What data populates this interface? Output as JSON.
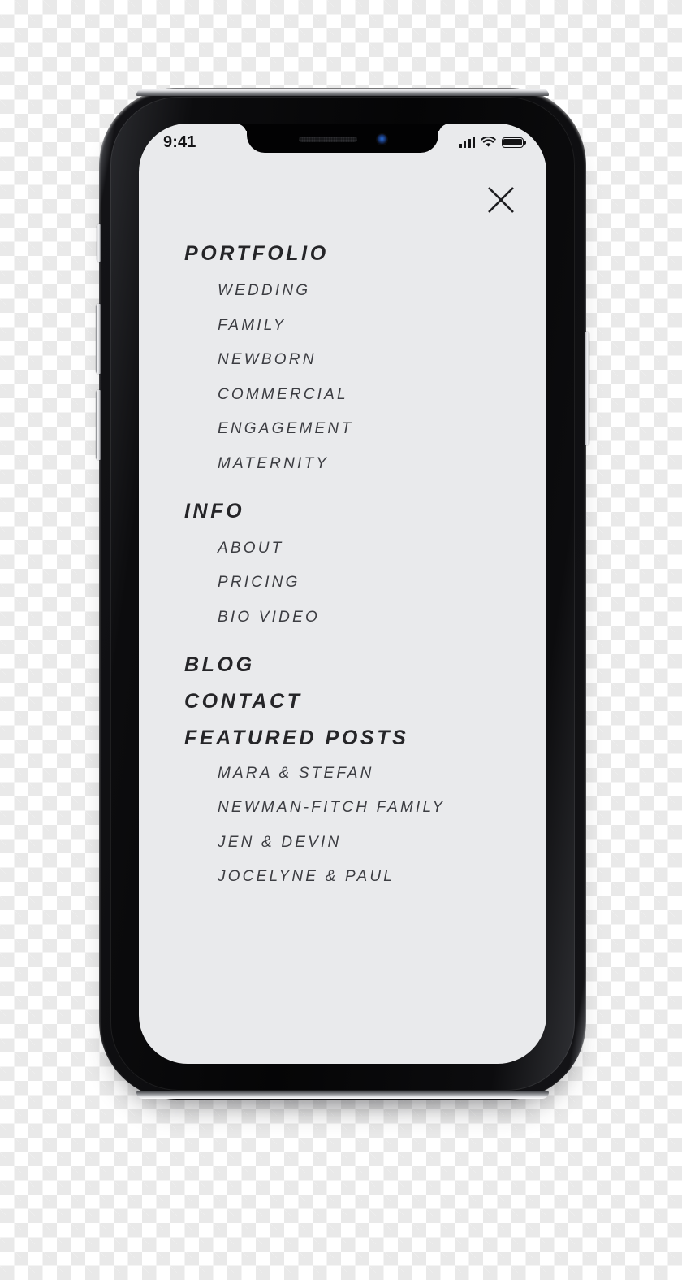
{
  "device": {
    "type": "smartphone-mockup",
    "status_bar": {
      "time": "9:41",
      "icons": [
        "signal-bars-icon",
        "wifi-icon",
        "battery-icon"
      ],
      "signal_bars": 4,
      "battery_full": true
    },
    "notch": {
      "speaker_icon": "earpiece-speaker",
      "camera_icon": "front-camera"
    }
  },
  "screen": {
    "background_color": "#e9eaec",
    "close_button": {
      "icon": "close-icon",
      "label": "X"
    },
    "menu": {
      "sections": [
        {
          "heading": "PORTFOLIO",
          "items": [
            "WEDDING",
            "FAMILY",
            "NEWBORN",
            "COMMERCIAL",
            "ENGAGEMENT",
            "MATERNITY"
          ]
        },
        {
          "heading": "INFO",
          "items": [
            "ABOUT",
            "PRICING",
            "BIO VIDEO"
          ]
        },
        {
          "heading": "BLOG",
          "items": []
        },
        {
          "heading": "CONTACT",
          "items": []
        },
        {
          "heading": "FEATURED POSTS",
          "items": [
            "MARA & STEFAN",
            "NEWMAN-FITCH FAMILY",
            "JEN & DEVIN",
            "JOCELYNE & PAUL"
          ]
        }
      ]
    }
  },
  "colors": {
    "heading_text": "#252528",
    "item_text": "#3c3d42",
    "screen_bg": "#e9eaec",
    "frame_dark": "#0a0a0c",
    "frame_metal": "#f2f2f4"
  }
}
